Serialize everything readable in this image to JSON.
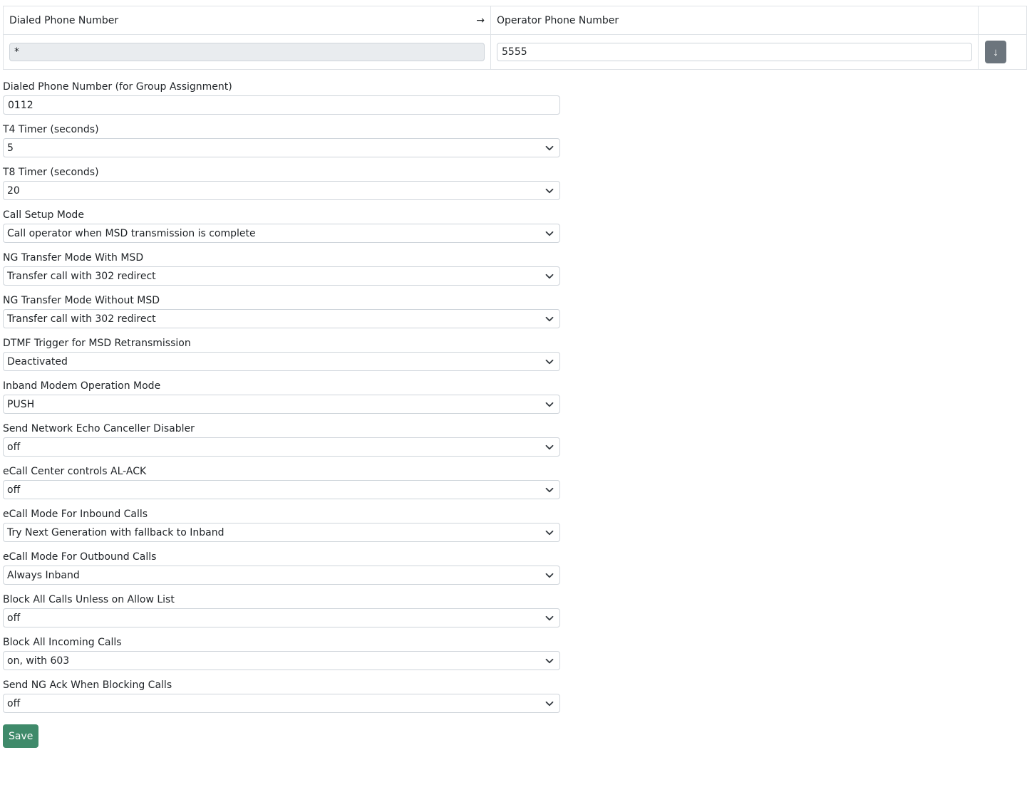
{
  "mapping_table": {
    "headers": {
      "dialed": "Dialed Phone Number",
      "arrow": "→",
      "operator": "Operator Phone Number"
    },
    "row": {
      "dialed_value": "*",
      "operator_value": "5555",
      "move_icon": "arrow-down-icon",
      "move_symbol": "↓"
    }
  },
  "group_number": {
    "label": "Dialed Phone Number (for Group Assignment)",
    "value": "0112"
  },
  "fields": [
    {
      "label": "T4 Timer (seconds)",
      "value": "5"
    },
    {
      "label": "T8 Timer (seconds)",
      "value": "20"
    },
    {
      "label": "Call Setup Mode",
      "value": "Call operator when MSD transmission is complete"
    },
    {
      "label": "NG Transfer Mode With MSD",
      "value": "Transfer call with 302 redirect"
    },
    {
      "label": "NG Transfer Mode Without MSD",
      "value": "Transfer call with 302 redirect"
    },
    {
      "label": "DTMF Trigger for MSD Retransmission",
      "value": "Deactivated"
    },
    {
      "label": "Inband Modem Operation Mode",
      "value": "PUSH"
    },
    {
      "label": "Send Network Echo Canceller Disabler",
      "value": "off"
    },
    {
      "label": "eCall Center controls AL-ACK",
      "value": "off"
    },
    {
      "label": "eCall Mode For Inbound Calls",
      "value": "Try Next Generation with fallback to Inband"
    },
    {
      "label": "eCall Mode For Outbound Calls",
      "value": "Always Inband"
    },
    {
      "label": "Block All Calls Unless on Allow List",
      "value": "off"
    },
    {
      "label": "Block All Incoming Calls",
      "value": "on, with 603"
    },
    {
      "label": "Send NG Ack When Blocking Calls",
      "value": "off"
    }
  ],
  "save_label": "Save",
  "colors": {
    "save_button": "#3f8a6a",
    "move_button": "#6c757d",
    "disabled_input": "#e9ecef",
    "border": "#dee2e6"
  }
}
